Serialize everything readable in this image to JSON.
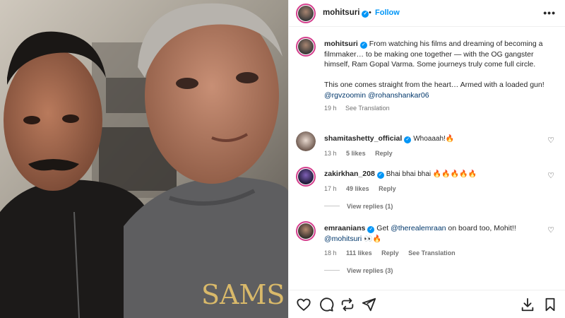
{
  "post": {
    "username": "mohitsuri",
    "dot": "•",
    "follow_label": "Follow",
    "more_label": "•••"
  },
  "caption": {
    "username": "mohitsuri",
    "text": "From watching his films and dreaming of becoming a filmmaker… to be making one together — with the OG gangster himself, Ram Gopal Varma. Some journeys truly come full circle.",
    "text2": "This one comes straight from the heart… Armed with a loaded gun!",
    "mentions": [
      "@rgvzoomin",
      "@rohanshankar06"
    ],
    "time": "19 h",
    "see_translation": "See Translation"
  },
  "comments": [
    {
      "username": "shamitashetty_official",
      "text": "Whoaaah!🔥",
      "time": "13 h",
      "likes": "5 likes",
      "reply": "Reply"
    },
    {
      "username": "zakirkhan_208",
      "text": "Bhai bhai bhai 🔥🔥🔥🔥🔥",
      "time": "17 h",
      "likes": "49 likes",
      "reply": "Reply",
      "view_replies": "View replies (1)"
    },
    {
      "username": "emraanians",
      "text_pre": "Get ",
      "mention1": "@therealemraan",
      "text_mid": " on board too, Mohit!!",
      "mention2": "@mohitsuri",
      "text_end": " 👀🔥",
      "time": "18 h",
      "likes": "111 likes",
      "reply": "Reply",
      "see_translation": "See Translation",
      "view_replies": "View replies (3)"
    }
  ],
  "photo": {
    "shirt_text": "SAMS"
  },
  "icons": {
    "like": "heart-icon",
    "comment": "comment-icon",
    "share": "repost-icon",
    "send": "send-icon",
    "save": "bookmark-icon",
    "download": "download-icon"
  },
  "colors": {
    "accent": "#0095f6",
    "mention": "#00376b",
    "muted": "#737373"
  }
}
